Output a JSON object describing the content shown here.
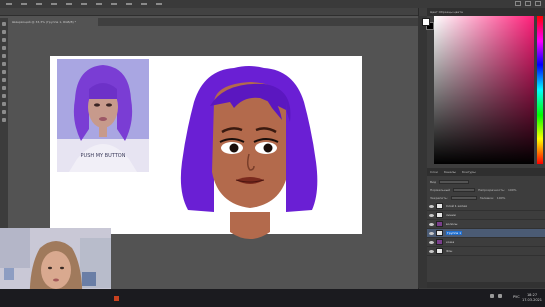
{
  "window": {
    "doc_tab_title": "Ше́нрёоций @ 33,3% (Группа 1, RGB/8) *",
    "color_panel_title": "Цвет  Образцы цвета"
  },
  "panels": {
    "layers_tabs": [
      "Слои",
      "Каналы",
      "Контуры"
    ],
    "layer_controls": {
      "search_placeholder": "Вид",
      "blend_mode": "Нормальный",
      "opacity_label": "Непрозрачность:",
      "opacity_value": "100%",
      "lock_label": "Закрепить:",
      "fill_label": "Заливка:",
      "fill_value": "100%"
    },
    "layers": [
      {
        "name": "Слой 1 копия",
        "active": false
      },
      {
        "name": "линии",
        "active": false
      },
      {
        "name": "волосы",
        "active": false
      },
      {
        "name": "Группа 1",
        "active": true,
        "editing": true
      },
      {
        "name": "кожа",
        "active": false
      },
      {
        "name": "Фон",
        "active": false
      }
    ]
  },
  "reference": {
    "shirt_text": "PUSH MY BUTTON"
  },
  "taskbar": {
    "lang": "РУС",
    "time": "18:27",
    "date": "17.03.2021"
  },
  "colors": {
    "hair": "#6a1fd4",
    "skin": "#b36a4c",
    "canvas": "#ffffff",
    "workspace": "#535353",
    "accent_layer": "#4b5b74"
  }
}
